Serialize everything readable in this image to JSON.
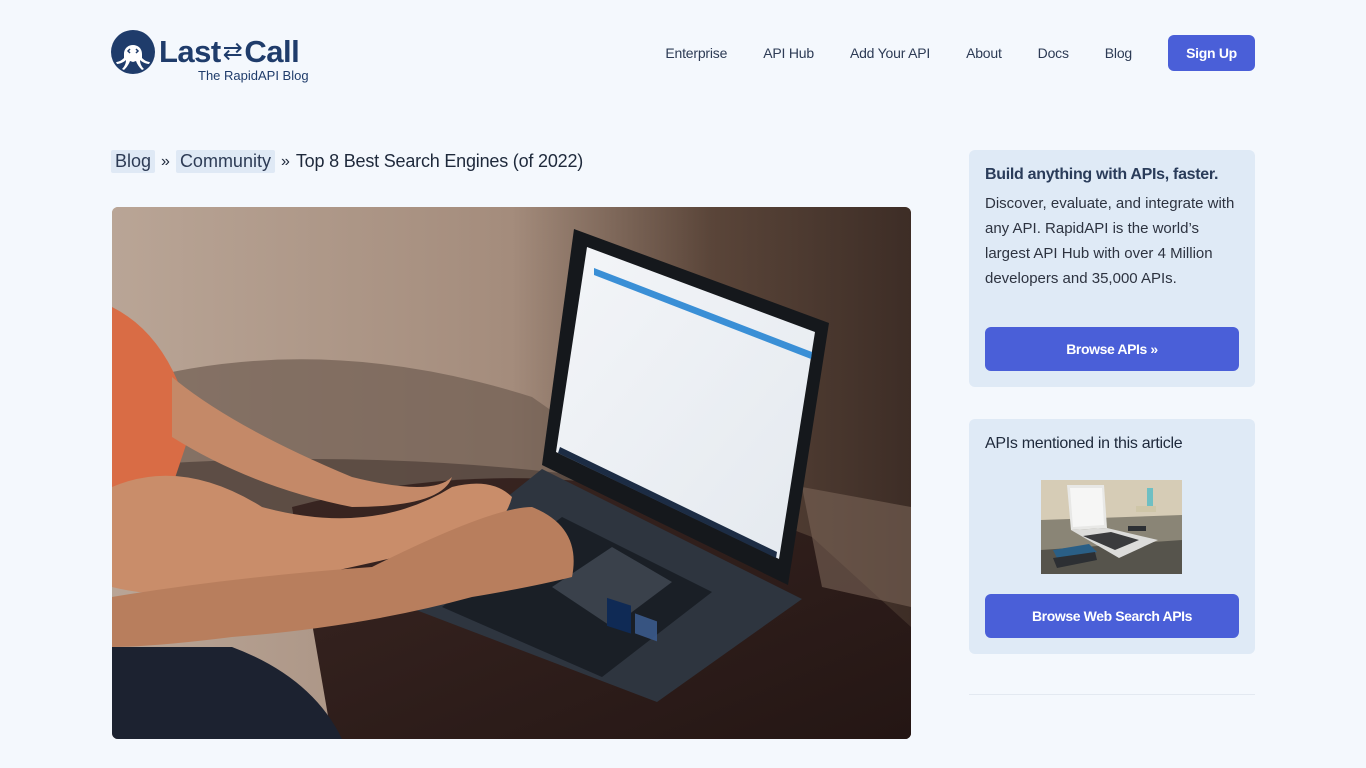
{
  "header": {
    "logo": {
      "name_left": "Last",
      "arrows_icon": "⇄",
      "name_right": "Call",
      "subtitle": "The RapidAPI Blog"
    },
    "nav": [
      {
        "label": "Enterprise"
      },
      {
        "label": "API Hub"
      },
      {
        "label": "Add Your API"
      },
      {
        "label": "About"
      },
      {
        "label": "Docs"
      },
      {
        "label": "Blog"
      }
    ],
    "signup_label": "Sign Up"
  },
  "breadcrumb": {
    "items": [
      {
        "label": "Blog"
      },
      {
        "label": "Community"
      }
    ],
    "separator": "»",
    "current": "Top 8 Best Search Engines (of 2022)"
  },
  "hero_image": {
    "alt": "Person typing on a laptop"
  },
  "sidebar": {
    "promo": {
      "title": "Build anything with APIs, faster.",
      "text": "Discover, evaluate, and integrate with any API. RapidAPI is the world’s largest API Hub with over 4 Million developers and 35,000 APIs.",
      "button_label": "Browse APIs »"
    },
    "mentioned": {
      "title": "APIs mentioned in this article",
      "image_alt": "Laptop on desk showing search engine",
      "button_label": "Browse Web Search APIs"
    }
  },
  "colors": {
    "accent": "#4a5fd8",
    "brand": "#1f3c6b",
    "card_bg": "#dfeaf6",
    "page_bg": "#f4f8fd"
  }
}
